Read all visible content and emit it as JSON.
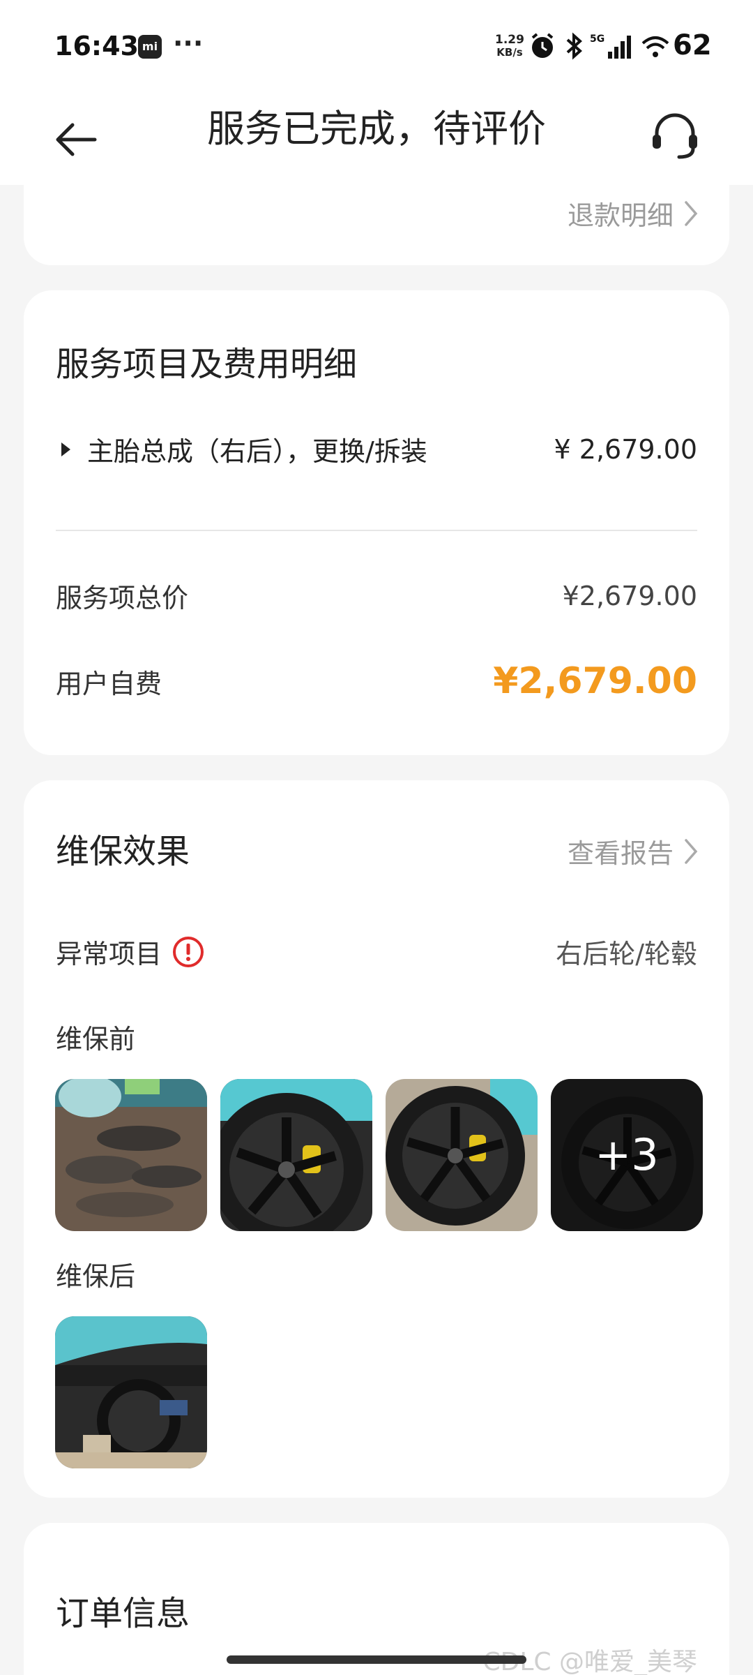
{
  "status_bar": {
    "time": "16:43",
    "app_badge": "mi",
    "dots": "···",
    "net_speed_value": "1.29",
    "net_speed_unit": "KB/s",
    "battery": "62"
  },
  "nav": {
    "title": "服务已完成，待评价",
    "back_icon": "arrow-left-icon",
    "support_icon": "headset-icon"
  },
  "refund": {
    "link_label": "退款明细"
  },
  "fees": {
    "title": "服务项目及费用明细",
    "items": [
      {
        "name": "主胎总成（右后），更换/拆装",
        "price": "¥ 2,679.00"
      }
    ],
    "total_label": "服务项总价",
    "total_value": "¥2,679.00",
    "self_pay_label": "用户自费",
    "self_pay_value": "¥2,679.00"
  },
  "maintenance": {
    "title": "维保效果",
    "report_label": "查看报告",
    "abnormal_label": "异常项目",
    "abnormal_value": "右后轮/轮毂",
    "before_label": "维保前",
    "before_more": "+3",
    "after_label": "维保后"
  },
  "order": {
    "title": "订单信息"
  },
  "watermark": "CDLC @唯爱_美琴",
  "colors": {
    "accent_orange": "#f39a1e",
    "alert_red": "#e02b2b",
    "background": "#f5f5f5"
  }
}
